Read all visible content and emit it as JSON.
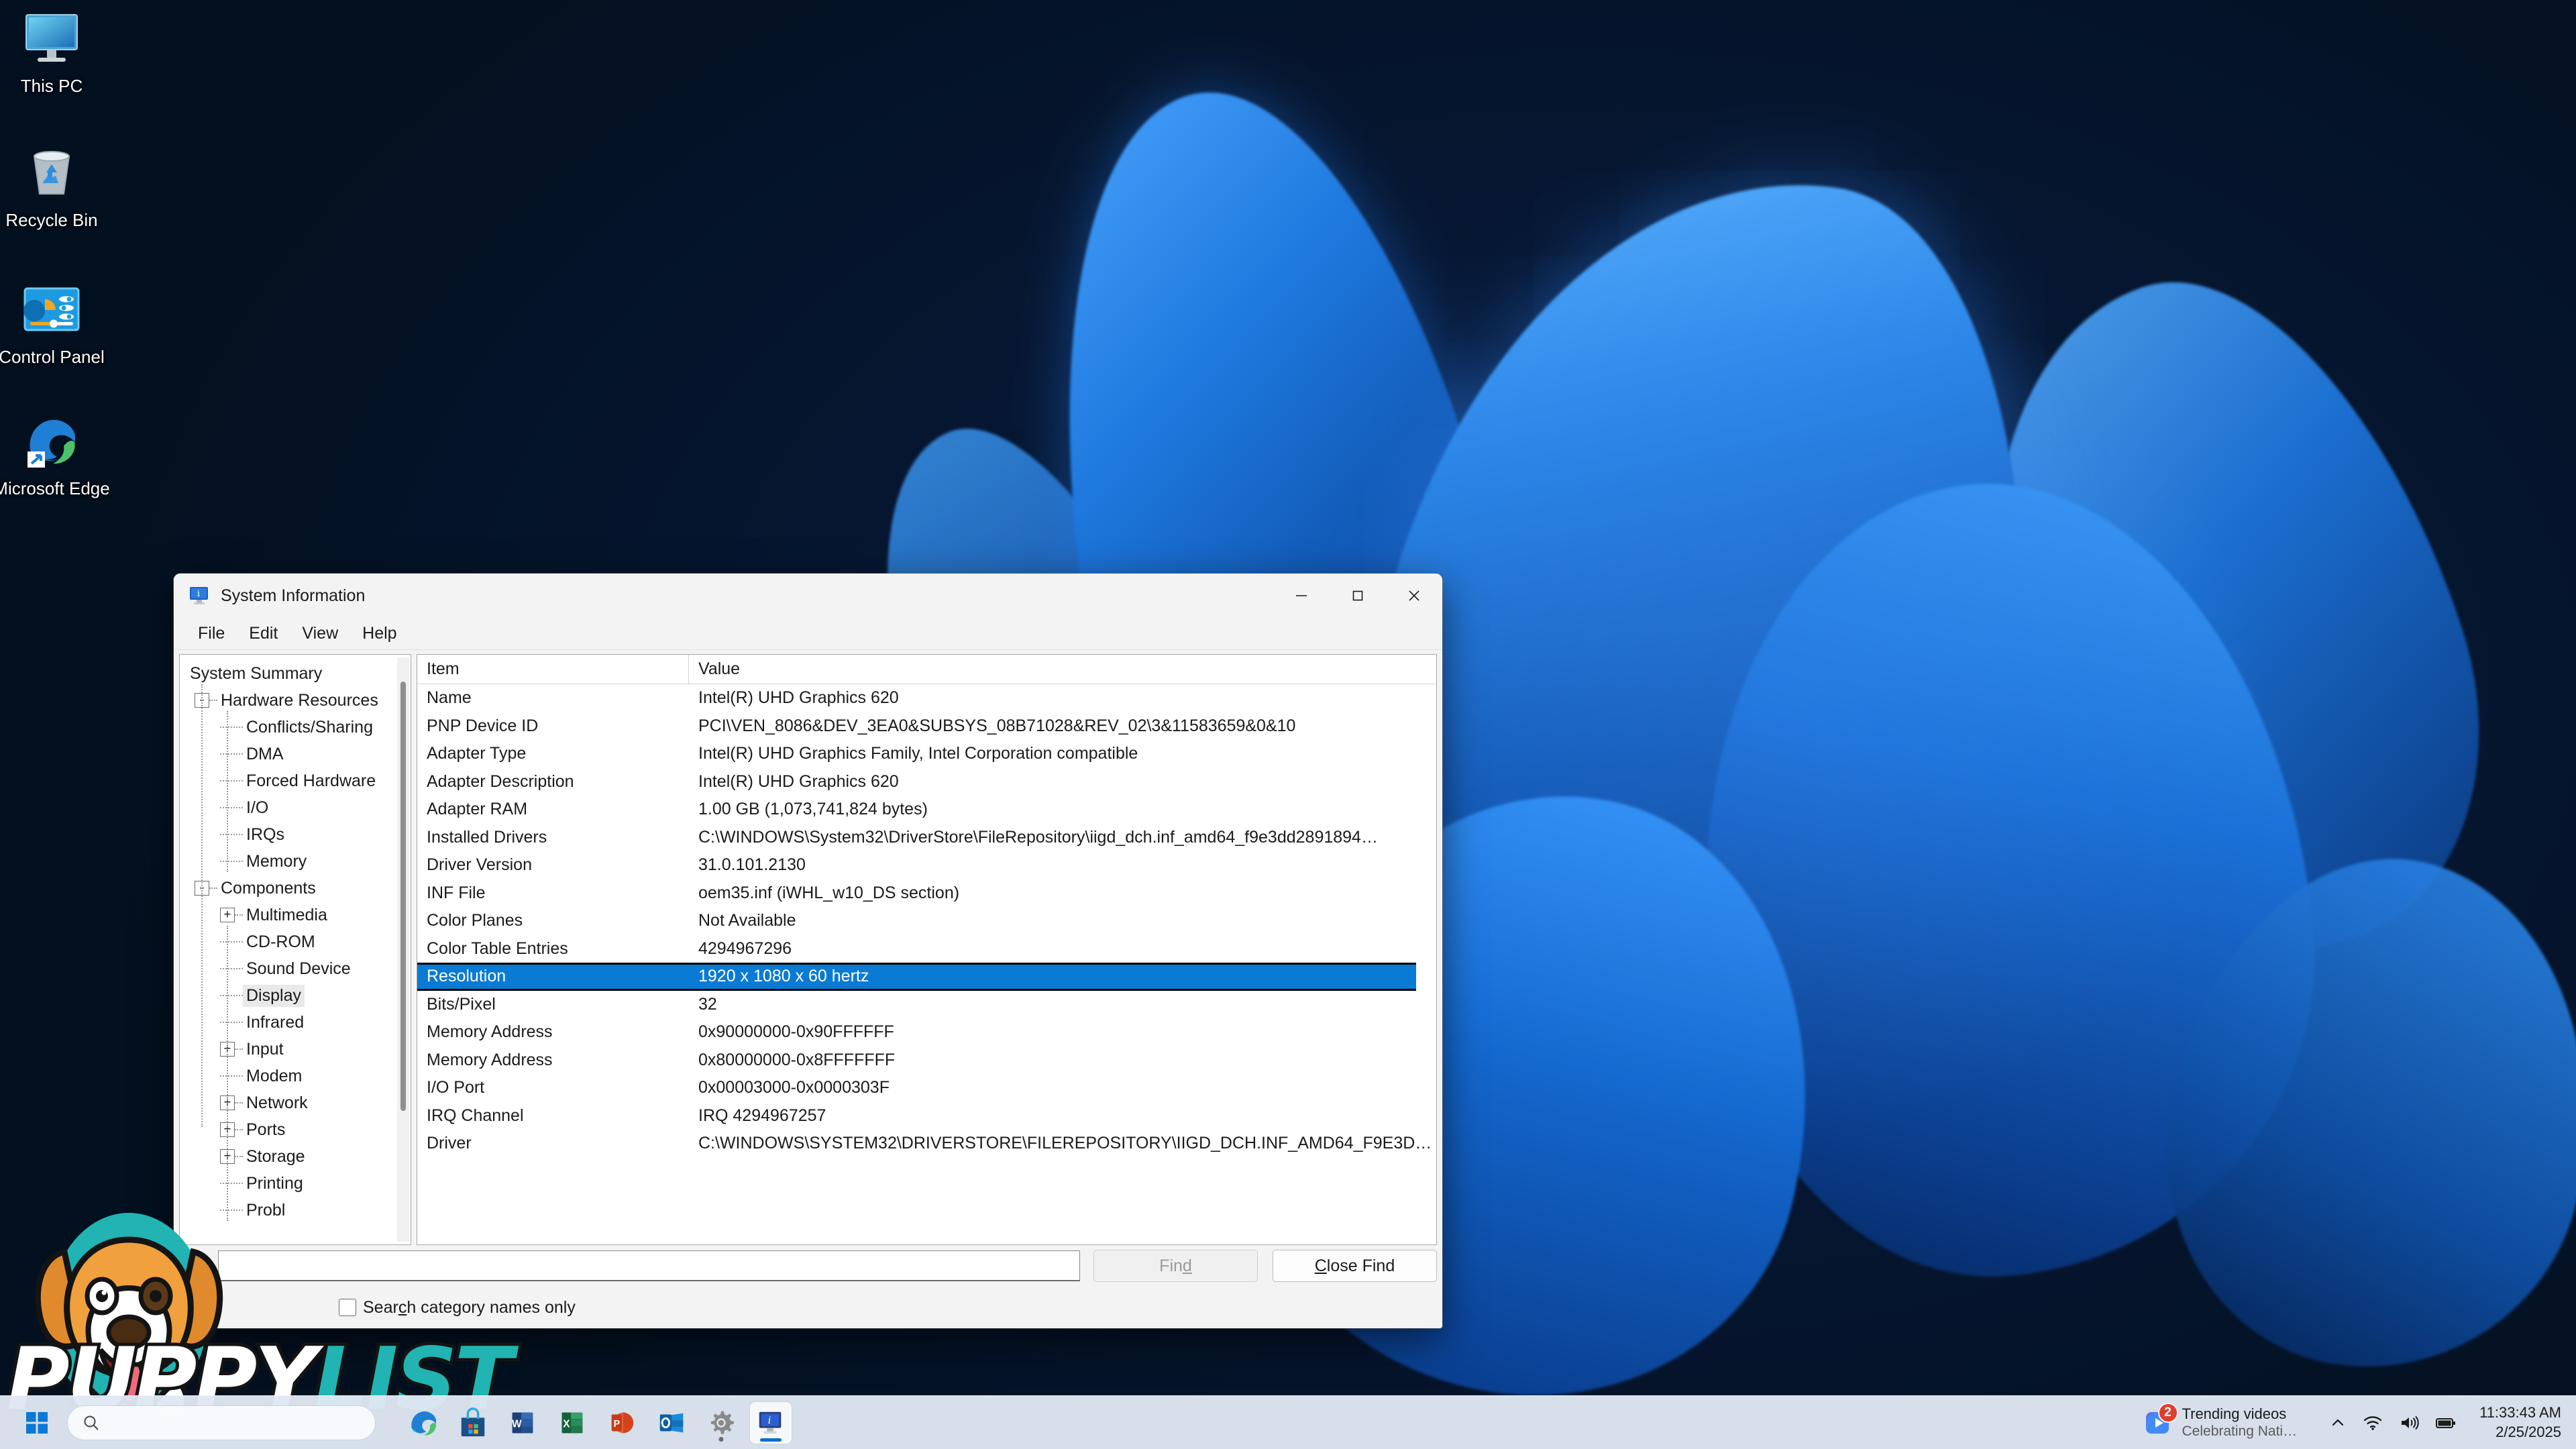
{
  "desktop": {
    "icons": [
      {
        "label": "This PC",
        "icon": "monitor-icon"
      },
      {
        "label": "Recycle Bin",
        "icon": "recycle-bin-icon"
      },
      {
        "label": "Control Panel",
        "icon": "control-panel-icon"
      },
      {
        "label": "Microsoft Edge",
        "icon": "edge-icon"
      }
    ]
  },
  "window": {
    "title": "System Information",
    "icon": "system-information-icon",
    "controls": {
      "minimize": "—",
      "maximize": "☐",
      "close": "✕"
    },
    "menu": [
      "File",
      "Edit",
      "View",
      "Help"
    ]
  },
  "tree": {
    "items": [
      {
        "label": "System Summary",
        "level": 0,
        "expander": "",
        "selected": false
      },
      {
        "label": "Hardware Resources",
        "level": 1,
        "expander": "-",
        "selected": false
      },
      {
        "label": "Conflicts/Sharing",
        "level": 2,
        "expander": "",
        "selected": false
      },
      {
        "label": "DMA",
        "level": 2,
        "expander": "",
        "selected": false
      },
      {
        "label": "Forced Hardware",
        "level": 2,
        "expander": "",
        "selected": false
      },
      {
        "label": "I/O",
        "level": 2,
        "expander": "",
        "selected": false
      },
      {
        "label": "IRQs",
        "level": 2,
        "expander": "",
        "selected": false
      },
      {
        "label": "Memory",
        "level": 2,
        "expander": "",
        "selected": false
      },
      {
        "label": "Components",
        "level": 1,
        "expander": "-",
        "selected": false
      },
      {
        "label": "Multimedia",
        "level": 2,
        "expander": "+",
        "selected": false
      },
      {
        "label": "CD-ROM",
        "level": 2,
        "expander": "",
        "selected": false
      },
      {
        "label": "Sound Device",
        "level": 2,
        "expander": "",
        "selected": false
      },
      {
        "label": "Display",
        "level": 2,
        "expander": "",
        "selected": true
      },
      {
        "label": "Infrared",
        "level": 2,
        "expander": "",
        "selected": false
      },
      {
        "label": "Input",
        "level": 2,
        "expander": "+",
        "selected": false
      },
      {
        "label": "Modem",
        "level": 2,
        "expander": "",
        "selected": false
      },
      {
        "label": "Network",
        "level": 2,
        "expander": "+",
        "selected": false
      },
      {
        "label": "Ports",
        "level": 2,
        "expander": "+",
        "selected": false
      },
      {
        "label": "Storage",
        "level": 2,
        "expander": "+",
        "selected": false
      },
      {
        "label": "Printing",
        "level": 2,
        "expander": "",
        "selected": false
      },
      {
        "label": "Probl",
        "level": 2,
        "expander": "",
        "selected": false
      }
    ]
  },
  "details": {
    "columns": [
      "Item",
      "Value"
    ],
    "rows": [
      {
        "item": "Name",
        "value": "Intel(R) UHD Graphics 620",
        "selected": false
      },
      {
        "item": "PNP Device ID",
        "value": "PCI\\VEN_8086&DEV_3EA0&SUBSYS_08B71028&REV_02\\3&11583659&0&10",
        "selected": false
      },
      {
        "item": "Adapter Type",
        "value": "Intel(R) UHD Graphics Family, Intel Corporation compatible",
        "selected": false
      },
      {
        "item": "Adapter Description",
        "value": "Intel(R) UHD Graphics 620",
        "selected": false
      },
      {
        "item": "Adapter RAM",
        "value": "1.00 GB (1,073,741,824 bytes)",
        "selected": false
      },
      {
        "item": "Installed Drivers",
        "value": "C:\\WINDOWS\\System32\\DriverStore\\FileRepository\\iigd_dch.inf_amd64_f9e3dd2891894…",
        "selected": false
      },
      {
        "item": "Driver Version",
        "value": "31.0.101.2130",
        "selected": false
      },
      {
        "item": "INF File",
        "value": "oem35.inf (iWHL_w10_DS section)",
        "selected": false
      },
      {
        "item": "Color Planes",
        "value": "Not Available",
        "selected": false
      },
      {
        "item": "Color Table Entries",
        "value": "4294967296",
        "selected": false
      },
      {
        "item": "Resolution",
        "value": "1920 x 1080 x 60 hertz",
        "selected": true
      },
      {
        "item": "Bits/Pixel",
        "value": "32",
        "selected": false
      },
      {
        "item": "Memory Address",
        "value": "0x90000000-0x90FFFFFF",
        "selected": false
      },
      {
        "item": "Memory Address",
        "value": "0x80000000-0x8FFFFFFF",
        "selected": false
      },
      {
        "item": "I/O Port",
        "value": "0x00003000-0x0000303F",
        "selected": false
      },
      {
        "item": "IRQ Channel",
        "value": "IRQ 4294967257",
        "selected": false
      },
      {
        "item": "Driver",
        "value": "C:\\WINDOWS\\SYSTEM32\\DRIVERSTORE\\FILEREPOSITORY\\IIGD_DCH.INF_AMD64_F9E3D…",
        "selected": false
      }
    ]
  },
  "findbar": {
    "label": "Find",
    "input_value": "",
    "find_button": "Find",
    "find_button_accel": "d",
    "find_button_enabled": false,
    "close_button": "Close Find",
    "close_button_accel": "C",
    "checkbox_label": "Search category names only",
    "checkbox_accel": "c",
    "checkbox_checked": false,
    "secondary_checkbox_checked": false
  },
  "watermark": {
    "text_part1": "PUPPY",
    "text_part2": "LIST",
    "color1": "#ffffff",
    "color2": "#22b3b3"
  },
  "taskbar": {
    "start": "start-icon",
    "search_placeholder": "",
    "apps": [
      {
        "name": "Microsoft Edge",
        "icon": "edge-icon",
        "active": false,
        "running": false
      },
      {
        "name": "Microsoft Store",
        "icon": "store-icon",
        "active": false,
        "running": false
      },
      {
        "name": "Word",
        "icon": "word-icon",
        "active": false,
        "running": false
      },
      {
        "name": "Excel",
        "icon": "excel-icon",
        "active": false,
        "running": false
      },
      {
        "name": "PowerPoint",
        "icon": "powerpoint-icon",
        "active": false,
        "running": false
      },
      {
        "name": "Outlook",
        "icon": "outlook-icon",
        "active": false,
        "running": false
      },
      {
        "name": "Settings",
        "icon": "gear-icon",
        "active": false,
        "running": true
      },
      {
        "name": "System Information",
        "icon": "system-information-icon",
        "active": true,
        "running": true
      }
    ],
    "widget": {
      "title": "Trending videos",
      "subtitle": "Celebrating Nati…",
      "badge": "2"
    },
    "tray": {
      "chevron": "show-hidden-icons",
      "wifi": "wifi-icon",
      "volume": "speaker-icon",
      "battery": "battery-icon"
    },
    "clock": {
      "time": "11:33:43 AM",
      "date": "2/25/2025"
    }
  }
}
